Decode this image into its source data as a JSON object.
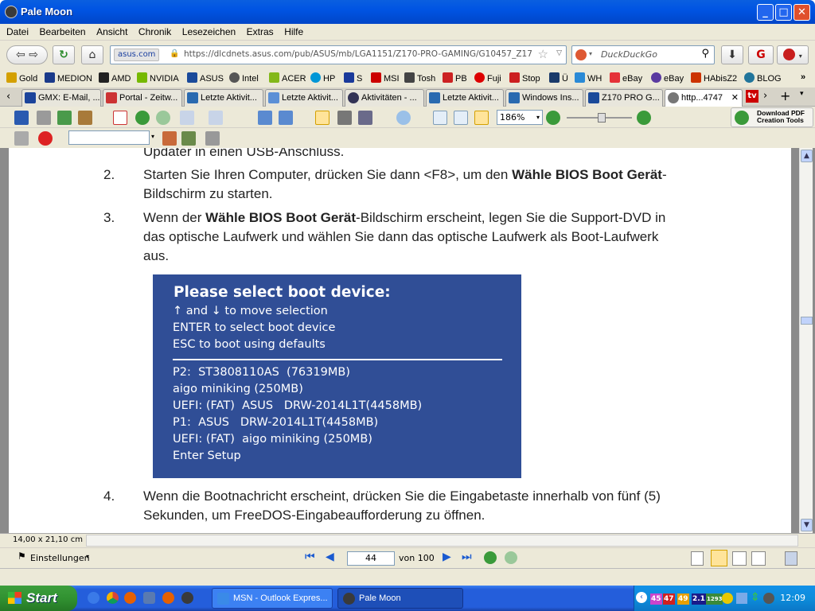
{
  "window": {
    "title": "Pale Moon",
    "minimize": "_",
    "maximize": "□",
    "close": "✕"
  },
  "menu": [
    "Datei",
    "Bearbeiten",
    "Ansicht",
    "Chronik",
    "Lesezeichen",
    "Extras",
    "Hilfe"
  ],
  "nav": {
    "site_identity": "asus.com",
    "url": "https://dlcdnets.asus.com/pub/ASUS/mb/LGA1151/Z170-PRO-GAMING/G10457_Z170_PRO",
    "search_placeholder": "DuckDuckGo"
  },
  "bookmarks": [
    {
      "label": "Gold",
      "color": "#d4a000"
    },
    {
      "label": "MEDION",
      "color": "#1a3a8a"
    },
    {
      "label": "AMD",
      "color": "#222222"
    },
    {
      "label": "NVIDIA",
      "color": "#76b900"
    },
    {
      "label": "ASUS",
      "color": "#1a4a9a"
    },
    {
      "label": "Intel",
      "color": "#555555"
    },
    {
      "label": "ACER",
      "color": "#83b81a"
    },
    {
      "label": "HP",
      "color": "#0096d6"
    },
    {
      "label": "S",
      "color": "#c0202a"
    },
    {
      "label": "MSI",
      "color": "#c00000"
    },
    {
      "label": "Tosh",
      "color": "#444444"
    },
    {
      "label": "PB",
      "color": "#cc2222"
    },
    {
      "label": "Fuji",
      "color": "#dd0000"
    },
    {
      "label": "Stop",
      "color": "#cc2020"
    },
    {
      "label": "Ü",
      "color": "#1a3a6a"
    },
    {
      "label": "WH",
      "color": "#2a8ad6"
    },
    {
      "label": "eBay",
      "color": "#e53238"
    },
    {
      "label": "eBay",
      "color": "#5a3aa0"
    },
    {
      "label": "HAbisZ2",
      "color": "#cc3300"
    },
    {
      "label": "BLOG",
      "color": "#21759b"
    }
  ],
  "tabs": [
    {
      "label": "GMX: E-Mail, ...",
      "color": "#1c449b"
    },
    {
      "label": "Portal - Zeitw...",
      "color": "#cc3333"
    },
    {
      "label": "Letzte Aktivit...",
      "color": "#2a6ab0"
    },
    {
      "label": "Letzte Aktivit...",
      "color": "#5b8fd6"
    },
    {
      "label": "Aktivitäten - ...",
      "color": "#333355"
    },
    {
      "label": "Letzte Aktivit...",
      "color": "#2a6ab0"
    },
    {
      "label": "Windows Ins...",
      "color": "#2a6ab0"
    },
    {
      "label": "Z170 PRO G...",
      "color": "#1a4a9a"
    },
    {
      "label": "http...4747",
      "color": "#777777"
    }
  ],
  "pdf_toolbar": {
    "zoom": "186%",
    "download_pdf_line1": "Download PDF",
    "download_pdf_line2": "Creation Tools"
  },
  "document": {
    "fragment_top": "Updater in einen USB-Anschluss.",
    "items": [
      {
        "number": "2.",
        "lines": [
          {
            "pre": "Starten Sie Ihren Computer, drücken Sie dann <F8>, um den ",
            "bold": "Wähle BIOS Boot Gerät",
            "post": "-"
          },
          {
            "pre": "Bildschirm zu starten.",
            "bold": "",
            "post": ""
          }
        ]
      },
      {
        "number": "3.",
        "lines": [
          {
            "pre": "Wenn der ",
            "bold": "Wähle BIOS Boot Gerät",
            "post": "-Bildschirm erscheint, legen Sie die Support-DVD in"
          },
          {
            "pre": "das optische Laufwerk und wählen Sie dann das optische Laufwerk als Boot-Laufwerk",
            "bold": "",
            "post": ""
          },
          {
            "pre": "aus.",
            "bold": "",
            "post": ""
          }
        ]
      },
      {
        "number": "4.",
        "lines": [
          {
            "pre": "Wenn die Bootnachricht erscheint, drücken Sie die Eingabetaste innerhalb von fünf (5)",
            "bold": "",
            "post": ""
          },
          {
            "pre": "Sekunden, um FreeDOS-Eingabeaufforderung zu öffnen.",
            "bold": "",
            "post": ""
          }
        ]
      }
    ],
    "bios_screen": {
      "title": "Please select boot device:",
      "help": [
        "↑ and ↓ to move selection",
        "ENTER to select boot device",
        "ESC to boot using defaults"
      ],
      "devices": [
        "P2:  ST3808110AS  (76319MB)",
        "aigo miniking (250MB)",
        "UEFI: (FAT)  ASUS   DRW-2014L1T(4458MB)",
        "P1:  ASUS   DRW-2014L1T(4458MB)",
        "UEFI: (FAT)  aigo miniking (250MB)",
        "Enter Setup"
      ]
    }
  },
  "page_size": "14,00 x 21,10 cm",
  "pdf_bottom": {
    "settings": "Einstellungen",
    "current_page": "44",
    "total_pages": "von 100"
  },
  "taskbar": {
    "start": "Start",
    "tasks": [
      {
        "label": "MSN - Outlook Expres..."
      },
      {
        "label": "Pale Moon"
      }
    ],
    "tray_badges": [
      "45",
      "47",
      "49",
      "2.1",
      "1293"
    ],
    "clock": "12:09"
  }
}
